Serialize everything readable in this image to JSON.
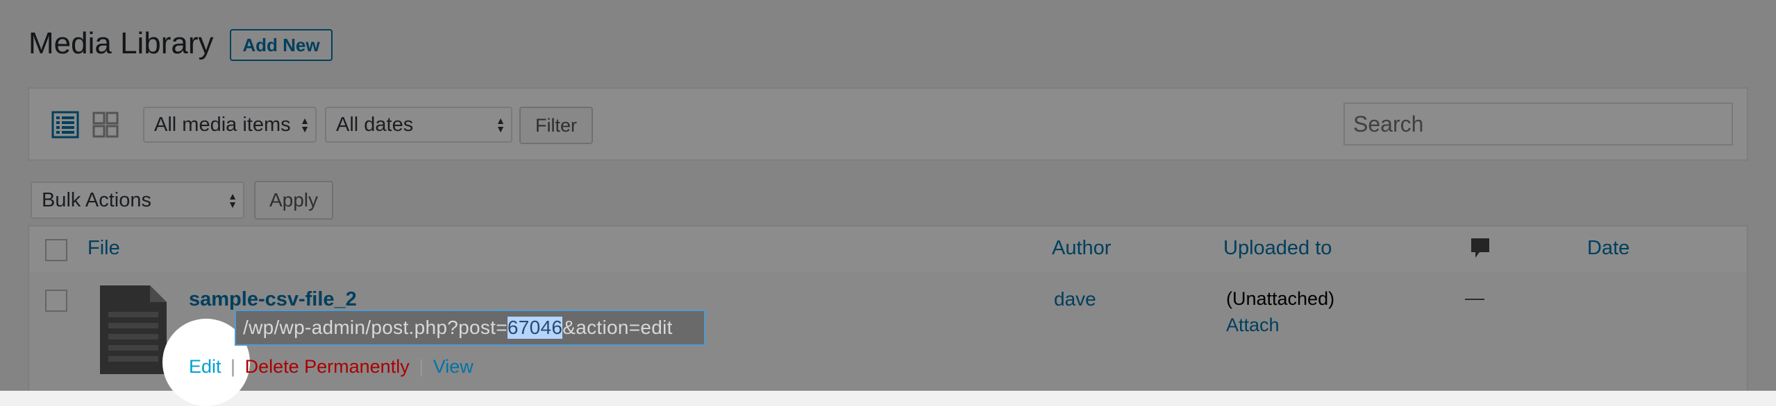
{
  "page": {
    "title": "Media Library",
    "add_new_label": "Add New"
  },
  "toolbar": {
    "media_filter": "All media items",
    "date_filter": "All dates",
    "filter_label": "Filter",
    "search_placeholder": "Search",
    "view_mode": "list"
  },
  "bulk": {
    "action": "Bulk Actions",
    "apply_label": "Apply"
  },
  "table": {
    "columns": {
      "file": "File",
      "author": "Author",
      "uploaded_to": "Uploaded to",
      "date": "Date"
    },
    "rows": [
      {
        "title": "sample-csv-file_2",
        "filename_partial": "samp",
        "author": "dave",
        "attachment": "(Unattached)",
        "attach_label": "Attach",
        "comments": "—",
        "actions": {
          "edit": "Edit",
          "separator": "|",
          "delete": "Delete Permanently",
          "view": "View"
        }
      }
    ]
  },
  "url_tooltip": {
    "prefix": "/wp/wp-admin/post.php?post=",
    "highlight": "67046",
    "suffix": "&action=edit"
  },
  "colors": {
    "link": "#0073aa",
    "delete": "#a00",
    "highlight": "#b5d5ff"
  }
}
